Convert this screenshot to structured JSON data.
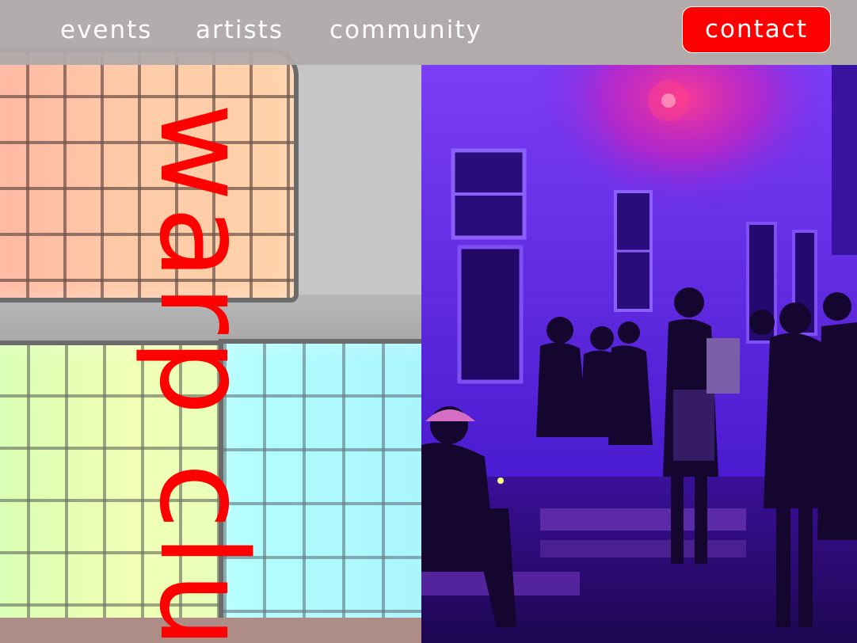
{
  "header": {
    "nav_items": [
      {
        "label": "events"
      },
      {
        "label": "artists"
      },
      {
        "label": "community"
      }
    ],
    "contact_label": "contact"
  },
  "hero": {
    "brand_text": "warp clu"
  },
  "colors": {
    "accent": "#ff0000",
    "header_bg": "#b0aaaa",
    "nav_text": "#ffffff",
    "photo_tint": "#5a24e8"
  }
}
